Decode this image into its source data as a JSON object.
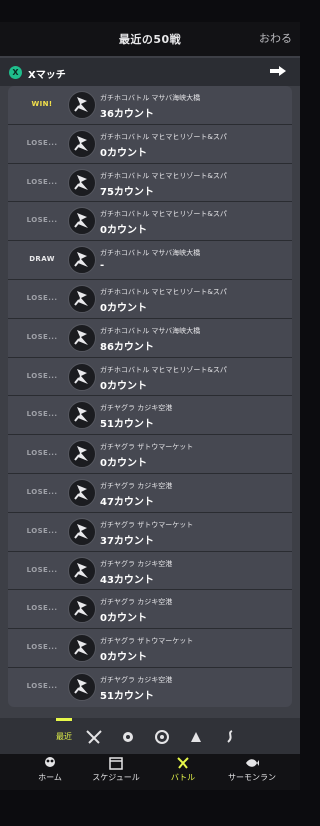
{
  "header": {
    "title": "最近の50戦",
    "close_label": "おわる"
  },
  "mode": {
    "icon": "x-match-icon",
    "label": "Xマッチ",
    "action_icon": "arrow-right-icon"
  },
  "battles": [
    {
      "result": "WIN!",
      "stage": "ガチホコバトル マサバ海峡大橋",
      "count": "36カウント"
    },
    {
      "result": "LOSE...",
      "stage": "ガチホコバトル マヒマヒリゾート&スパ",
      "count": "0カウント"
    },
    {
      "result": "LOSE...",
      "stage": "ガチホコバトル マヒマヒリゾート&スパ",
      "count": "75カウント"
    },
    {
      "result": "LOSE...",
      "stage": "ガチホコバトル マヒマヒリゾート&スパ",
      "count": "0カウント"
    },
    {
      "result": "DRAW",
      "stage": "ガチホコバトル マサバ海峡大橋",
      "count": "-"
    },
    {
      "result": "LOSE...",
      "stage": "ガチホコバトル マヒマヒリゾート&スパ",
      "count": "0カウント"
    },
    {
      "result": "LOSE...",
      "stage": "ガチホコバトル マサバ海峡大橋",
      "count": "86カウント"
    },
    {
      "result": "LOSE...",
      "stage": "ガチホコバトル マヒマヒリゾート&スパ",
      "count": "0カウント"
    },
    {
      "result": "LOSE...",
      "stage": "ガチヤグラ カジキ空港",
      "count": "51カウント"
    },
    {
      "result": "LOSE...",
      "stage": "ガチヤグラ ザトウマーケット",
      "count": "0カウント"
    },
    {
      "result": "LOSE...",
      "stage": "ガチヤグラ カジキ空港",
      "count": "47カウント"
    },
    {
      "result": "LOSE...",
      "stage": "ガチヤグラ ザトウマーケット",
      "count": "37カウント"
    },
    {
      "result": "LOSE...",
      "stage": "ガチヤグラ カジキ空港",
      "count": "43カウント"
    },
    {
      "result": "LOSE...",
      "stage": "ガチヤグラ カジキ空港",
      "count": "0カウント"
    },
    {
      "result": "LOSE...",
      "stage": "ガチヤグラ ザトウマーケット",
      "count": "0カウント"
    },
    {
      "result": "LOSE...",
      "stage": "ガチヤグラ カジキ空港",
      "count": "51カウント"
    }
  ],
  "filter": {
    "active_label": "最近"
  },
  "nav": {
    "home": "ホーム",
    "schedule": "スケジュール",
    "battle": "バトル",
    "salmon": "サーモンラン"
  },
  "colors": {
    "accent": "#e7f84a",
    "win": "#f3e14b",
    "xmatch": "#1fbe8c"
  }
}
